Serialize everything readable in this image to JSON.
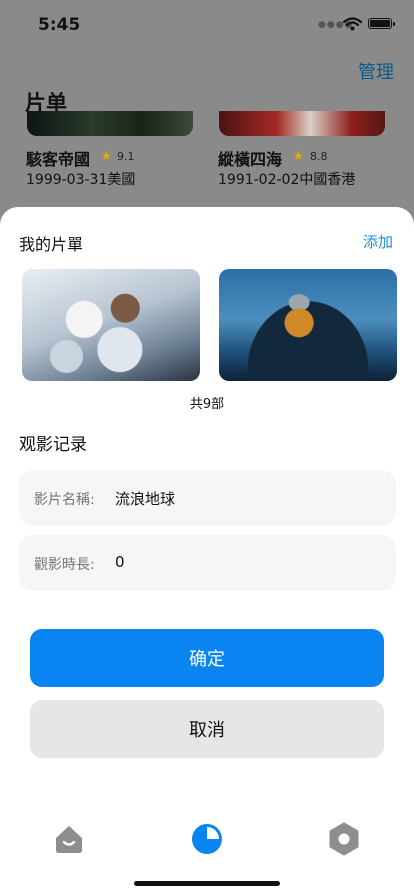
{
  "status_bar": {
    "time": "5:45"
  },
  "background": {
    "manage_label": "管理",
    "section_title": "片单",
    "movies": [
      {
        "name": "駭客帝國",
        "rating": "9.1",
        "meta": "1999-03-31美國"
      },
      {
        "name": "縱橫四海",
        "rating": "8.8",
        "meta": "1991-02-02中國香港"
      }
    ]
  },
  "sheet": {
    "my_list": {
      "title": "我的片單",
      "add_label": "添加",
      "count_text": "共9部"
    },
    "record": {
      "title": "观影记录",
      "fields": [
        {
          "label": "影片名稱:",
          "value": "流浪地球"
        },
        {
          "label": "觀影時長:",
          "value": "0"
        }
      ]
    },
    "confirm_label": "确定",
    "cancel_label": "取消"
  },
  "tab_bar": {
    "items": [
      {
        "icon": "home-icon",
        "color": "#8e8e8e"
      },
      {
        "icon": "pie-chart-icon",
        "color": "#0a84f0"
      },
      {
        "icon": "settings-icon",
        "color": "#8e8e8e"
      }
    ]
  }
}
